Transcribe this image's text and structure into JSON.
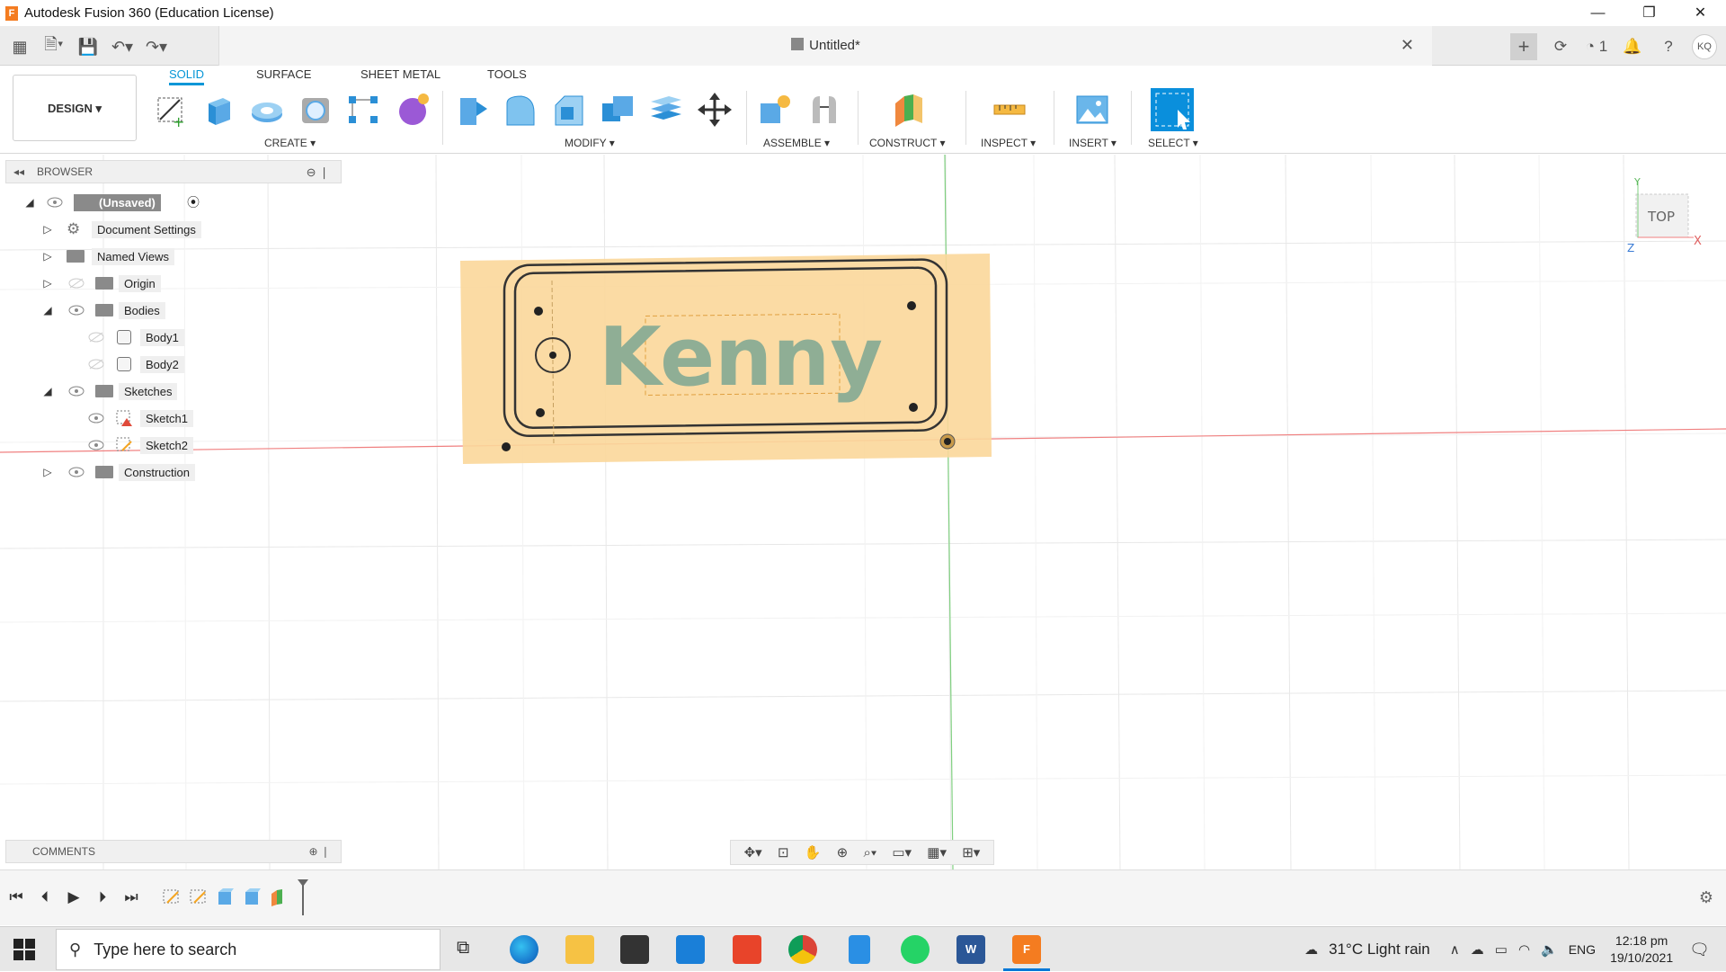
{
  "window": {
    "title": "Autodesk Fusion 360 (Education License)",
    "minimize": "—",
    "restore": "❐",
    "close": "✕"
  },
  "quickaccess": {
    "doc_title": "Untitled*",
    "doc_close": "✕",
    "job_count": "1",
    "avatar": "KQ"
  },
  "ribbon": {
    "workspace": "DESIGN ▾",
    "tabs": [
      "SOLID",
      "SURFACE",
      "SHEET METAL",
      "TOOLS"
    ],
    "groups": [
      "CREATE ▾",
      "MODIFY ▾",
      "ASSEMBLE ▾",
      "CONSTRUCT ▾",
      "INSPECT ▾",
      "INSERT ▾",
      "SELECT ▾"
    ]
  },
  "browser": {
    "title": "BROWSER",
    "items": [
      {
        "label": "(Unsaved)"
      },
      {
        "label": "Document Settings"
      },
      {
        "label": "Named Views"
      },
      {
        "label": "Origin"
      },
      {
        "label": "Bodies"
      },
      {
        "label": "Body1"
      },
      {
        "label": "Body2"
      },
      {
        "label": "Sketches"
      },
      {
        "label": "Sketch1"
      },
      {
        "label": "Sketch2"
      },
      {
        "label": "Construction"
      }
    ]
  },
  "viewport": {
    "text": "Kenny",
    "viewcube_face": "TOP",
    "axis_x": "X",
    "axis_y": "Y",
    "axis_z": "Z",
    "colors": {
      "plate": "#fbd79a",
      "text": "#8fae95",
      "x_axis": "#f08080",
      "y_axis": "#80d080"
    }
  },
  "comments": {
    "title": "COMMENTS"
  },
  "taskbar": {
    "search_placeholder": "Type here to search",
    "weather": "31°C  Light rain",
    "language": "ENG",
    "time": "12:18 pm",
    "date": "19/10/2021"
  }
}
